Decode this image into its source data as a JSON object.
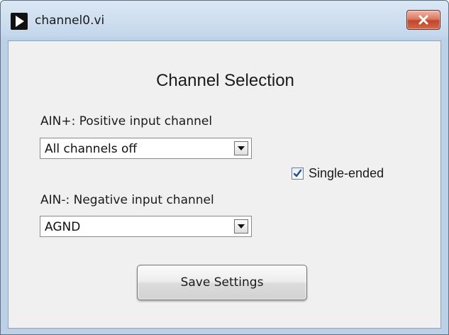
{
  "window": {
    "title": "channel0.vi",
    "icon": "run-arrow-icon",
    "close_icon": "close-x-icon"
  },
  "panel": {
    "heading": "Channel Selection",
    "positive": {
      "label": "AIN+: Positive input channel",
      "selected": "All channels off"
    },
    "negative": {
      "label": "AIN-: Negative input channel",
      "selected": "AGND"
    },
    "single_ended": {
      "label": "Single-ended",
      "checked": true
    },
    "save_label": "Save Settings"
  },
  "colors": {
    "close_button": "#c5432b",
    "client_background": "#f0f0f0",
    "checkmark": "#1f4e93"
  }
}
